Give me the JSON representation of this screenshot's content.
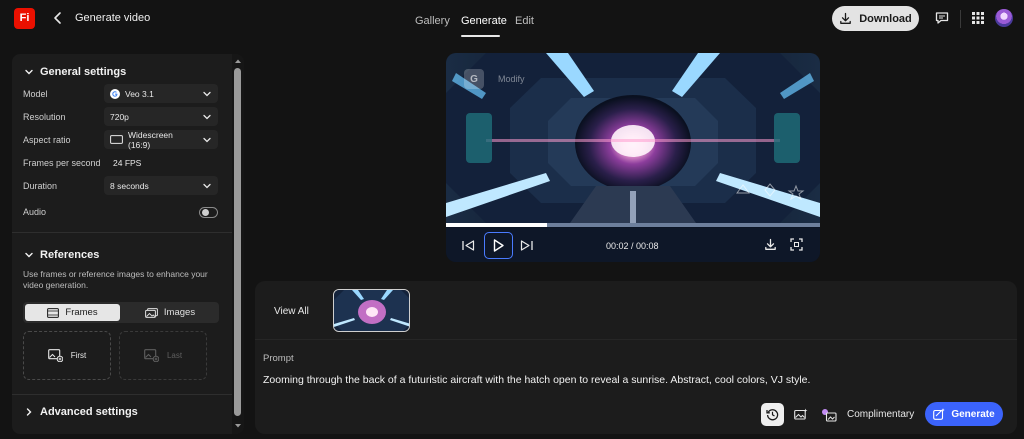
{
  "app": {
    "logo_text": "Fi",
    "title": "Generate video",
    "brand_color": "#eb1000"
  },
  "nav": {
    "tabs": [
      {
        "label": "Gallery"
      },
      {
        "label": "Generate",
        "active": true
      },
      {
        "label": "Edit"
      }
    ]
  },
  "header_actions": {
    "download_label": "Download",
    "icons": [
      "comment-icon",
      "apps-grid-icon",
      "avatar"
    ]
  },
  "settings": {
    "general_title": "General settings",
    "model": {
      "label": "Model",
      "value": "Veo 3.1",
      "icon": "google-g-icon"
    },
    "resolution": {
      "label": "Resolution",
      "value": "720p"
    },
    "aspect_ratio": {
      "label": "Aspect ratio",
      "value": "Widescreen (16:9)"
    },
    "fps": {
      "label": "Frames per second",
      "value": "24 FPS"
    },
    "duration": {
      "label": "Duration",
      "value": "8 seconds"
    },
    "audio": {
      "label": "Audio",
      "enabled": false
    }
  },
  "references": {
    "title": "References",
    "description": "Use frames or reference images to enhance your video generation.",
    "tabs": [
      {
        "label": "Frames",
        "active": true
      },
      {
        "label": "Images"
      }
    ],
    "slots": [
      {
        "label": "First"
      },
      {
        "label": "Last"
      }
    ]
  },
  "advanced": {
    "title": "Advanced settings"
  },
  "video": {
    "overlay_label": "Modify",
    "overlay_badge": "G",
    "time": "00:02 / 00:08",
    "progress": 0.27
  },
  "history": {
    "view_all": "View All"
  },
  "prompt": {
    "label": "Prompt",
    "text": "Zooming through the back of a futuristic aircraft with the hatch open to reveal a sunrise. Abstract, cool colors, VJ style."
  },
  "footer": {
    "complimentary": "Complimentary",
    "generate_label": "Generate",
    "accent": "#3b63fb"
  }
}
